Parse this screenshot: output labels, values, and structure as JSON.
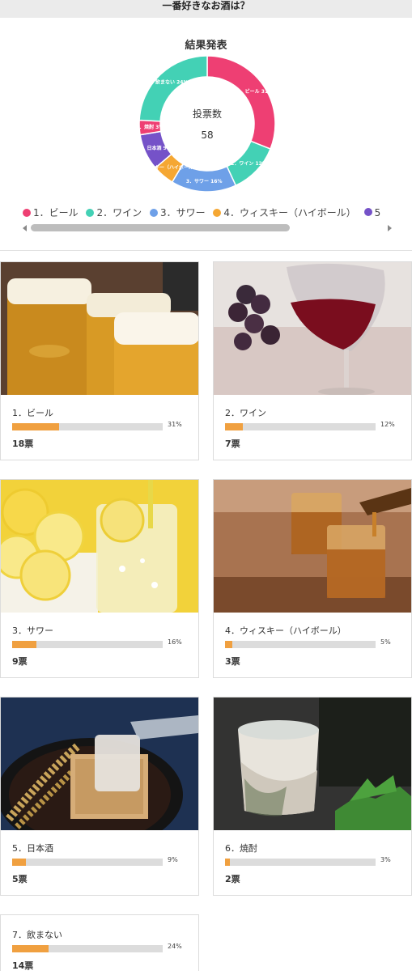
{
  "page": {
    "title": "一番好きなお酒は？"
  },
  "results": {
    "title": "結果発表",
    "center_label": "投票数",
    "total": "58"
  },
  "chart_data": {
    "type": "pie",
    "title": "結果発表",
    "categories": [
      "1．ビール",
      "2．ワイン",
      "3．サワー",
      "4．ウィスキー（ハイボール）",
      "5．日本酒",
      "6．焼酎",
      "7．飲まない"
    ],
    "values": [
      18,
      7,
      9,
      3,
      5,
      2,
      14
    ],
    "percent_labels": [
      "31%",
      "12%",
      "16%",
      "5%",
      "9%",
      "3%",
      "24%"
    ],
    "colors": [
      "#ee3f73",
      "#43d1b5",
      "#6ea0e8",
      "#f5a733",
      "#7552c8",
      "#ee3f73",
      "#43d1b5"
    ],
    "legend_position": "bottom"
  },
  "legend": [
    {
      "label": "1．ビール",
      "color": "#ee3f73"
    },
    {
      "label": "2．ワイン",
      "color": "#43d1b5"
    },
    {
      "label": "3．サワー",
      "color": "#6ea0e8"
    },
    {
      "label": "4．ウィスキー（ハイボール）",
      "color": "#f5a733"
    },
    {
      "label": "5",
      "color": "#7552c8"
    }
  ],
  "options": [
    {
      "name": "1．ビール",
      "percent": "31%",
      "votes": "18票",
      "fraction": 0.31,
      "image": "beer-image"
    },
    {
      "name": "2．ワイン",
      "percent": "12%",
      "votes": "7票",
      "fraction": 0.12,
      "image": "wine-image"
    },
    {
      "name": "3．サワー",
      "percent": "16%",
      "votes": "9票",
      "fraction": 0.16,
      "image": "sour-image"
    },
    {
      "name": "4．ウィスキー（ハイボール）",
      "percent": "5%",
      "votes": "3票",
      "fraction": 0.05,
      "image": "whisky-image"
    },
    {
      "name": "5．日本酒",
      "percent": "9%",
      "votes": "5票",
      "fraction": 0.09,
      "image": "sake-image"
    },
    {
      "name": "6．焼酎",
      "percent": "3%",
      "votes": "2票",
      "fraction": 0.03,
      "image": "shochu-image"
    },
    {
      "name": "7．飲まない",
      "percent": "24%",
      "votes": "14票",
      "fraction": 0.24,
      "image": ""
    }
  ]
}
